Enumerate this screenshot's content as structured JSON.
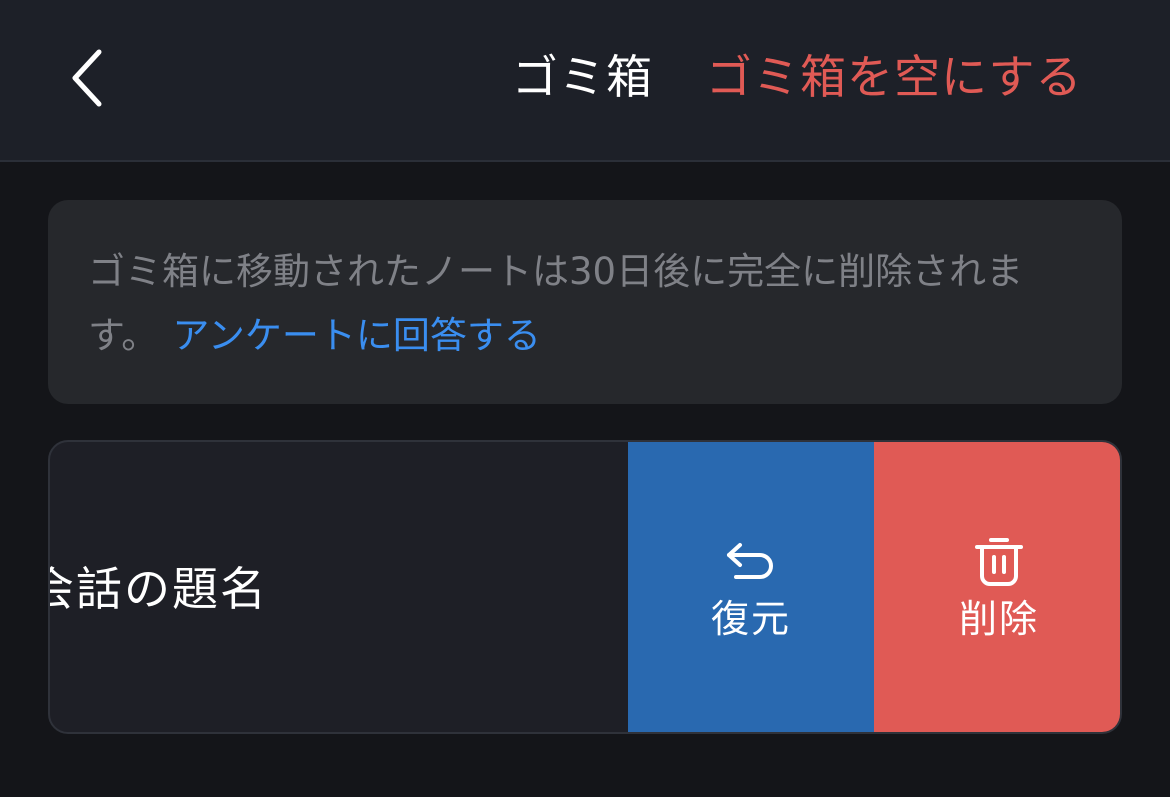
{
  "header": {
    "title": "ゴミ箱",
    "empty_trash_label": "ゴミ箱を空にする",
    "back_icon": "chevron-left-icon"
  },
  "notice": {
    "text": "ゴミ箱に移動されたノートは30日後に完全に削除されます。",
    "link_label": "アンケートに回答する"
  },
  "note": {
    "title": "会話の題名",
    "actions": {
      "restore_label": "復元",
      "restore_icon": "undo-arrow-icon",
      "delete_label": "削除",
      "delete_icon": "trash-icon"
    }
  },
  "colors": {
    "accent_red": "#e05a55",
    "link_blue": "#3a8ef0",
    "restore_blue": "#2969b0",
    "background": "#141519",
    "header_bg": "#1d2028"
  }
}
